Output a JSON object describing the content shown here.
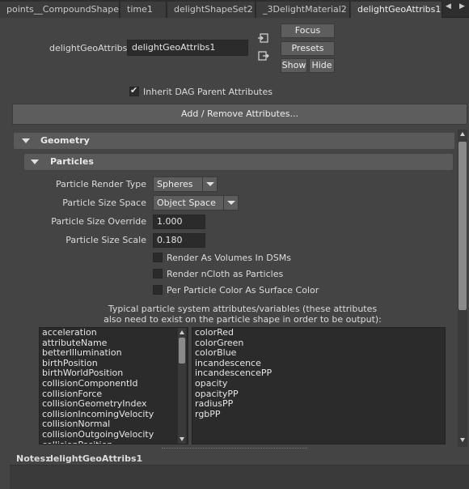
{
  "tabs": [
    {
      "label": "points__CompoundShape",
      "active": false
    },
    {
      "label": "time1",
      "active": false
    },
    {
      "label": "delightShapeSet2",
      "active": false
    },
    {
      "label": "_3DelightMaterial2",
      "active": false
    },
    {
      "label": "delightGeoAttribs1",
      "active": true
    }
  ],
  "header": {
    "node_label": "delightGeoAttribs:",
    "node_value": "delightGeoAttribs1",
    "focus_label": "Focus",
    "presets_label": "Presets",
    "show_label": "Show",
    "hide_label": "Hide"
  },
  "inherit_dag": {
    "label": "Inherit DAG Parent Attributes",
    "checked": true
  },
  "add_remove_label": "Add / Remove Attributes...",
  "geometry_title": "Geometry",
  "particles": {
    "title": "Particles",
    "render_type_label": "Particle Render Type",
    "render_type_value": "Spheres",
    "size_space_label": "Particle Size Space",
    "size_space_value": "Object Space",
    "size_override_label": "Particle Size Override",
    "size_override_value": "1.000",
    "size_scale_label": "Particle Size Scale",
    "size_scale_value": "0.180",
    "checkboxes": [
      {
        "label": "Render As Volumes In DSMs",
        "checked": false
      },
      {
        "label": "Render nCloth as Particles",
        "checked": false
      },
      {
        "label": "Per Particle Color As Surface Color",
        "checked": false
      }
    ],
    "info_line1": "Typical particle system attributes/variables (these attributes",
    "info_line2": "also need to exist on the particle shape in order to be output):",
    "left_list": [
      "acceleration",
      "attributeName",
      "betterIllumination",
      "birthPosition",
      "birthWorldPosition",
      "collisionComponentId",
      "collisionForce",
      "collisionGeometryIndex",
      "collisionIncomingVelocity",
      "collisionNormal",
      "collisionOutgoingVelocity",
      "collisionPosition"
    ],
    "right_list": [
      "colorRed",
      "colorGreen",
      "colorBlue",
      "incandescence",
      "incandescencePP",
      "opacity",
      "opacityPP",
      "radiusPP",
      "rgbPP"
    ]
  },
  "notes": {
    "label": "Notes:",
    "value": "delightGeoAttribs1"
  }
}
